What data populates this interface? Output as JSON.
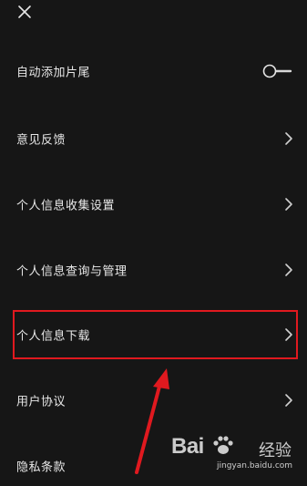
{
  "header": {
    "close_icon": "close-icon"
  },
  "settings": {
    "items": [
      {
        "label": "自动添加片尾",
        "control": "toggle",
        "toggle_on": false
      },
      {
        "label": "意见反馈",
        "control": "chevron"
      },
      {
        "label": "个人信息收集设置",
        "control": "chevron"
      },
      {
        "label": "个人信息查询与管理",
        "control": "chevron"
      },
      {
        "label": "个人信息下载",
        "control": "chevron",
        "highlighted": true
      },
      {
        "label": "用户协议",
        "control": "chevron"
      },
      {
        "label": "隐私条款",
        "control": "none"
      }
    ]
  },
  "annotation": {
    "highlight_color": "#e0191f",
    "arrow_color": "#e0191f"
  },
  "watermark": {
    "main": "Bai",
    "main_suffix": "经验",
    "sub": "jingyan.baidu.com"
  }
}
